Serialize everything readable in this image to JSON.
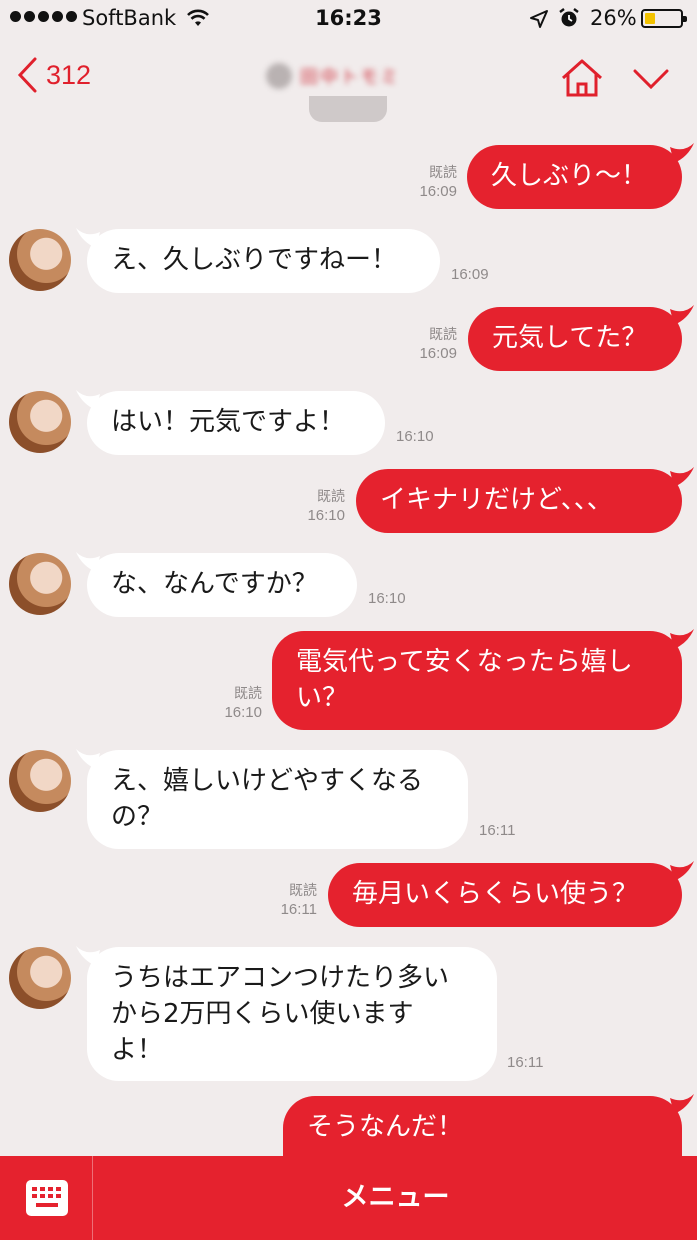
{
  "status_bar": {
    "carrier": "SoftBank",
    "time": "16:23",
    "battery": "26%"
  },
  "header": {
    "back_count": "312",
    "contact_name": "田中トモミ"
  },
  "messages": [
    {
      "dir": "out",
      "text": "久しぶり〜！",
      "read": "既読",
      "time": "16:09"
    },
    {
      "dir": "in",
      "text": "え、久しぶりですねー！",
      "time": "16:09"
    },
    {
      "dir": "out",
      "text": "元気してた？",
      "read": "既読",
      "time": "16:09"
    },
    {
      "dir": "in",
      "text": "はい！元気ですよ！",
      "time": "16:10"
    },
    {
      "dir": "out",
      "text": "イキナリだけど、、、",
      "read": "既読",
      "time": "16:10"
    },
    {
      "dir": "in",
      "text": "な、なんですか？",
      "time": "16:10"
    },
    {
      "dir": "out",
      "lines": [
        "電気代って安くなったら嬉し",
        "い？"
      ],
      "read": "既読",
      "time": "16:10"
    },
    {
      "dir": "in",
      "lines": [
        "え、嬉しいけどやすくなる",
        "の？"
      ],
      "time": "16:11"
    },
    {
      "dir": "out",
      "text": "毎月いくらくらい使う？",
      "read": "既読",
      "time": "16:11"
    },
    {
      "dir": "in",
      "lines": [
        "うちはエアコンつけたり多い",
        "から2万円くらい使います",
        "よ！"
      ],
      "time": "16:11"
    },
    {
      "dir": "out",
      "lines": [
        "そうなんだ！"
      ]
    }
  ],
  "bottom": {
    "menu_label": "メニュー"
  },
  "colors": {
    "accent": "#e5222e",
    "chat_background": "#f1ecec",
    "incoming_bubble": "#ffffff"
  }
}
